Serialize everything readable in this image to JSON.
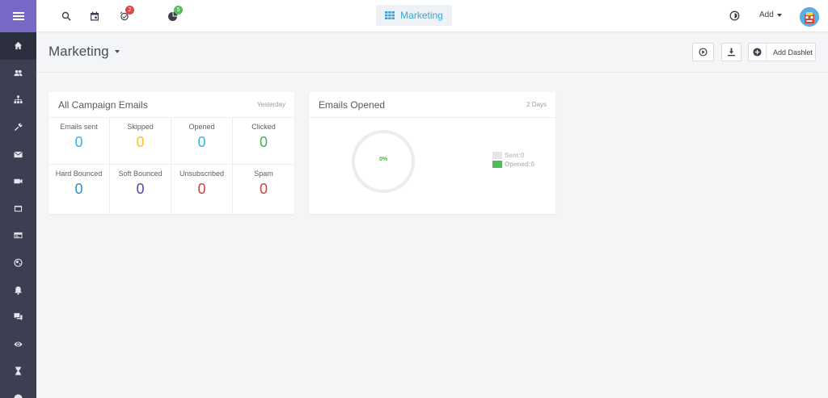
{
  "sidebar": {
    "items": [
      {
        "icon": "hamburger-icon"
      },
      {
        "icon": "home-icon"
      },
      {
        "icon": "users-icon"
      },
      {
        "icon": "org-chart-icon"
      },
      {
        "icon": "tools-icon"
      },
      {
        "icon": "mail-icon"
      },
      {
        "icon": "video-icon"
      },
      {
        "icon": "window-icon"
      },
      {
        "icon": "card-icon"
      },
      {
        "icon": "globe-icon"
      },
      {
        "icon": "bell-icon"
      },
      {
        "icon": "chat-icon"
      },
      {
        "icon": "eye-icon"
      },
      {
        "icon": "hourglass-icon"
      },
      {
        "icon": "globe-icon"
      }
    ]
  },
  "topbar": {
    "reminders_badge": "2",
    "activity_badge": "5",
    "active_tab": "Marketing",
    "add_label": "Add"
  },
  "page": {
    "title": "Marketing",
    "add_dashlet_label": "Add Dashlet"
  },
  "campaign_emails": {
    "title": "All Campaign Emails",
    "period": "Yesterday",
    "stats": [
      {
        "label": "Emails sent",
        "value": "0",
        "color": "#3ab0e2"
      },
      {
        "label": "Skipped",
        "value": "0",
        "color": "#f5c531"
      },
      {
        "label": "Opened",
        "value": "0",
        "color": "#3ab0e2"
      },
      {
        "label": "Clicked",
        "value": "0",
        "color": "#4caf50"
      },
      {
        "label": "Hard Bounced",
        "value": "0",
        "color": "#3a8fb7"
      },
      {
        "label": "Soft Bounced",
        "value": "0",
        "color": "#4b4ca0"
      },
      {
        "label": "Unsubscribed",
        "value": "0",
        "color": "#c8453f"
      },
      {
        "label": "Spam",
        "value": "0",
        "color": "#c8453f"
      }
    ]
  },
  "emails_opened": {
    "title": "Emails Opened",
    "period": "2 Days",
    "percent_label": "0%",
    "legend": [
      {
        "label": "Sent:0",
        "color": "#e6e6e6",
        "text_color": "#c4c4c4"
      },
      {
        "label": "Opened:0",
        "color": "#4cbb5a",
        "text_color": "#bdbdbd"
      }
    ]
  }
}
